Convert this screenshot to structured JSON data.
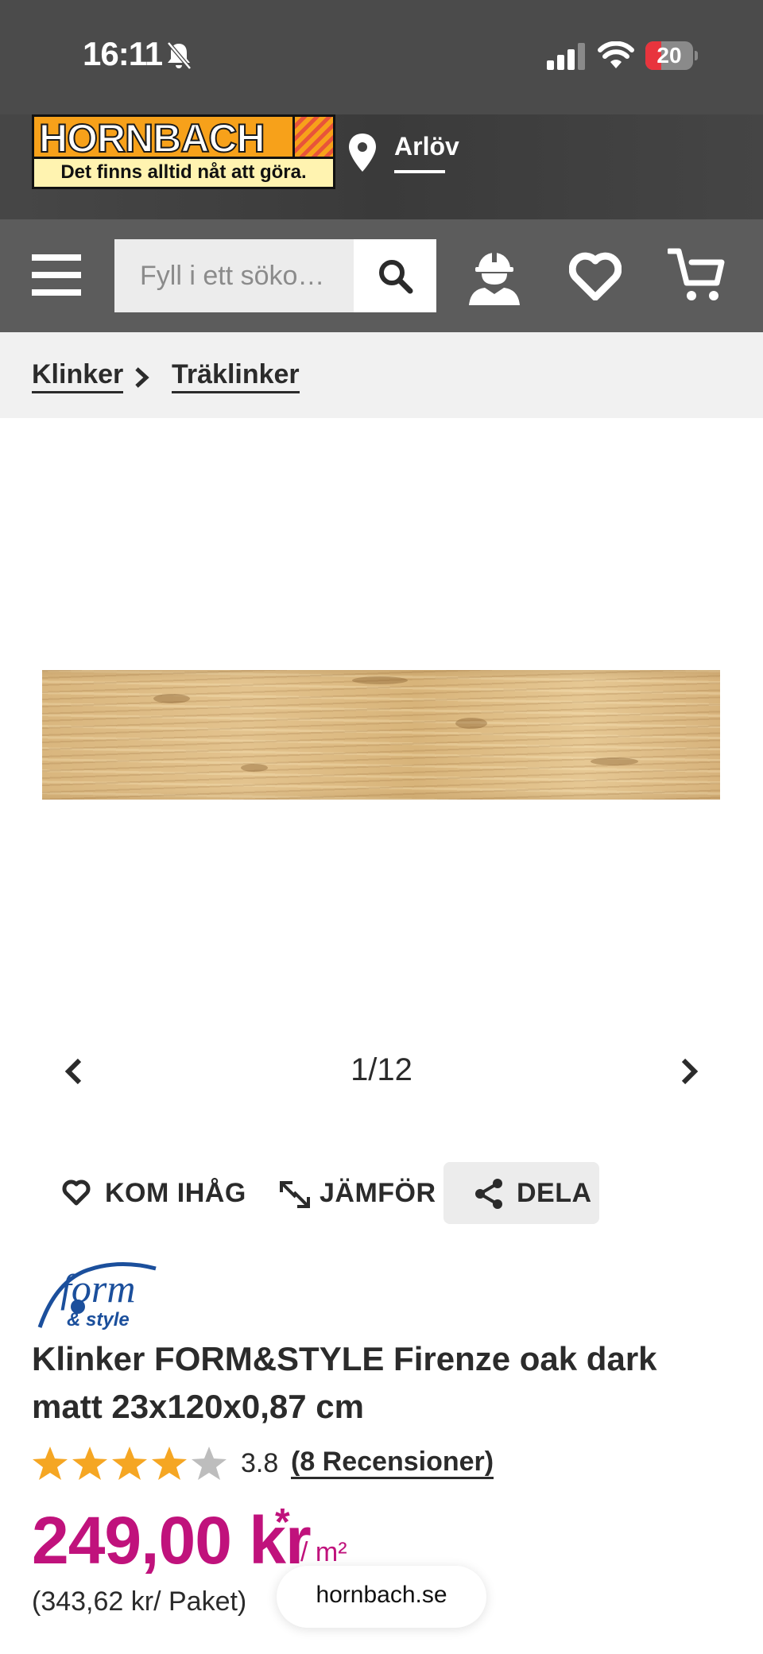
{
  "status_bar": {
    "time": "16:11",
    "battery": "20"
  },
  "header": {
    "logo_text": "HORNBACH",
    "slogan": "Det finns alltid nåt att göra.",
    "location": "Arlöv"
  },
  "search": {
    "placeholder": "Fyll i ett söko…"
  },
  "breadcrumb": [
    "Klinker",
    "Träklinker"
  ],
  "gallery": {
    "counter": "1/12"
  },
  "actions": {
    "remember": "KOM IHÅG",
    "compare": "JÄMFÖR",
    "share": "DELA"
  },
  "brand": {
    "line1": "form",
    "line2": "& style"
  },
  "product": {
    "title": "Klinker FORM&STYLE Firenze oak dark matt 23x120x0,87 cm",
    "rating": "3.8",
    "rating_value": 3.8,
    "rating_max": 5,
    "reviews": "(8 Recensioner)",
    "price": "249,00 kr",
    "price_mark": "*",
    "price_unit": "/ m²",
    "package_price": "(343,62 kr/ Paket)"
  },
  "browser": {
    "url": "hornbach.se"
  },
  "colors": {
    "price": "#c0127c",
    "star": "#f5a623",
    "header": "#4b4b4b",
    "navbar": "#5c5c5c"
  }
}
